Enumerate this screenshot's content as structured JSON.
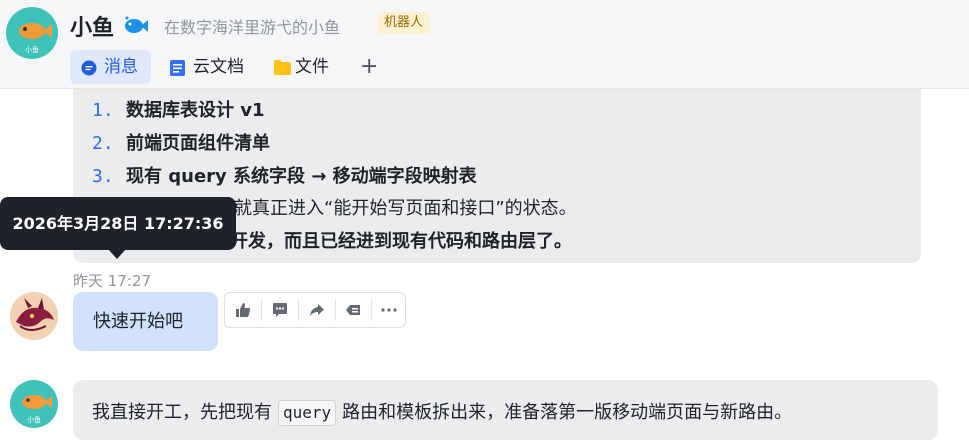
{
  "header": {
    "title": "小鱼",
    "description": "在数字海洋里游弋的小鱼",
    "badge": "机器人",
    "avatar_text": "小鱼",
    "tabs": [
      {
        "label": "消息",
        "icon": "message-icon",
        "active": true
      },
      {
        "label": "云文档",
        "icon": "doc-icon",
        "active": false
      },
      {
        "label": "文件",
        "icon": "folder-icon",
        "active": false
      }
    ],
    "add_tab": "+"
  },
  "messages": {
    "list_items": [
      {
        "num": "1.",
        "text": "数据库表设计 v1"
      },
      {
        "num": "2.",
        "text": "前端页面组件清单"
      },
      {
        "num": "3.",
        "text": "现有 query 系统字段 → 移动端字段映射表"
      }
    ],
    "para1": "这三份出来，开发就真正进入“能开始写页面和接口”的状态。",
    "para2": "开发，而且已经进到现有代码和路由层了。",
    "tooltip": "2026年3月28日 17:27:36",
    "timestamp": "昨天 17:27",
    "user_message": "快速开始吧",
    "bot_text_before": "我直接开工，先把现有",
    "bot_code": "query",
    "bot_text_after": "路由和模板拆出来，准备落第一版移动端页面与新路由。",
    "bot_avatar_text": "小鱼"
  },
  "toolbar": {
    "icons": [
      "thumbs-up-icon",
      "comment-icon",
      "forward-icon",
      "quote-icon",
      "more-icon"
    ]
  },
  "colors": {
    "accent": "#245bdb",
    "bot_avatar": "#3fc3b9",
    "user_bubble": "#cfe1fb",
    "bot_bubble": "#ebeced"
  }
}
